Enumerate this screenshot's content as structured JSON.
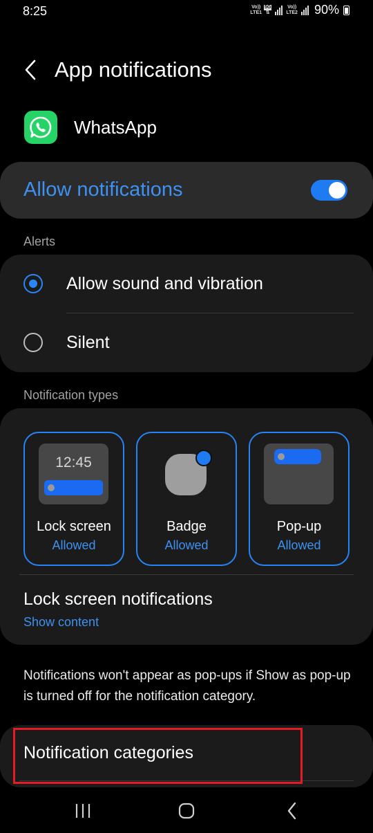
{
  "status_bar": {
    "time": "8:25",
    "sim1_label_top": "Vo))",
    "sim1_label_bottom": "LTE1",
    "network_label": "5G",
    "sim2_label_top": "Vo))",
    "sim2_label_bottom": "LTE2",
    "battery_percent": "90%"
  },
  "header": {
    "title": "App notifications"
  },
  "app": {
    "name": "WhatsApp",
    "icon": "whatsapp-icon",
    "icon_color": "#25d366"
  },
  "allow_notifications": {
    "label": "Allow notifications",
    "enabled": true,
    "accent_color": "#3e91f1"
  },
  "alerts": {
    "section_label": "Alerts",
    "options": [
      {
        "label": "Allow sound and vibration",
        "selected": true
      },
      {
        "label": "Silent",
        "selected": false
      }
    ]
  },
  "notification_types": {
    "section_label": "Notification types",
    "tiles": [
      {
        "label": "Lock screen",
        "status": "Allowed",
        "preview_time": "12:45"
      },
      {
        "label": "Badge",
        "status": "Allowed"
      },
      {
        "label": "Pop-up",
        "status": "Allowed"
      }
    ],
    "lock_screen_notifications": {
      "title": "Lock screen notifications",
      "value": "Show content"
    }
  },
  "info_text": "Notifications won't appear as pop-ups if Show as pop-up is turned off for the notification category.",
  "notification_categories": {
    "label": "Notification categories",
    "highlight_color": "#e21b24"
  },
  "nav_bar": {
    "icons": [
      "recents-icon",
      "home-icon",
      "back-icon"
    ]
  }
}
